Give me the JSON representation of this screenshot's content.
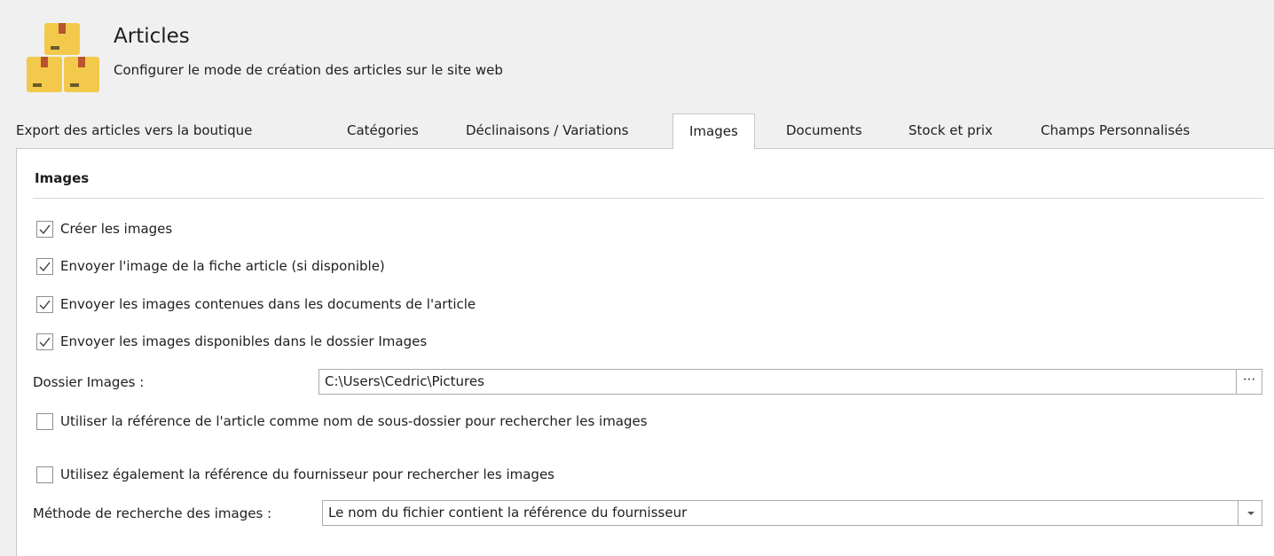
{
  "header": {
    "title": "Articles",
    "subtitle": "Configurer le mode de création des articles sur le site web",
    "icon": "boxes-icon"
  },
  "tabs": [
    {
      "label": "Export des articles vers la boutique"
    },
    {
      "label": "Catégories"
    },
    {
      "label": "Déclinaisons / Variations"
    },
    {
      "label": "Images"
    },
    {
      "label": "Documents"
    },
    {
      "label": "Stock et prix"
    },
    {
      "label": "Champs Personnalisés"
    }
  ],
  "active_tab": "Images",
  "section": {
    "title": "Images"
  },
  "options": {
    "create_images": {
      "label": "Créer les images",
      "checked": true
    },
    "send_card_image": {
      "label": "Envoyer l'image de la fiche article (si disponible)",
      "checked": true
    },
    "send_document_images": {
      "label": "Envoyer les images contenues dans les documents de l'article",
      "checked": true
    },
    "send_folder_images": {
      "label": "Envoyer les images disponibles dans le dossier Images",
      "checked": true
    },
    "use_reference_subfolder": {
      "label": "Utiliser la référence de l'article comme nom de sous-dossier pour rechercher les images",
      "checked": false
    },
    "use_supplier_reference": {
      "label": "Utilisez également la référence du fournisseur pour rechercher les images",
      "checked": false
    }
  },
  "folder": {
    "label": "Dossier Images :",
    "value": "C:\\Users\\Cedric\\Pictures",
    "browse_label": "···"
  },
  "search_method": {
    "label": "Méthode de recherche des images :",
    "value": "Le nom du fichier contient la référence du fournisseur"
  },
  "colors": {
    "box": "#f3c94b",
    "box_dark": "#d9a82a",
    "check": "#3c3c3c"
  }
}
